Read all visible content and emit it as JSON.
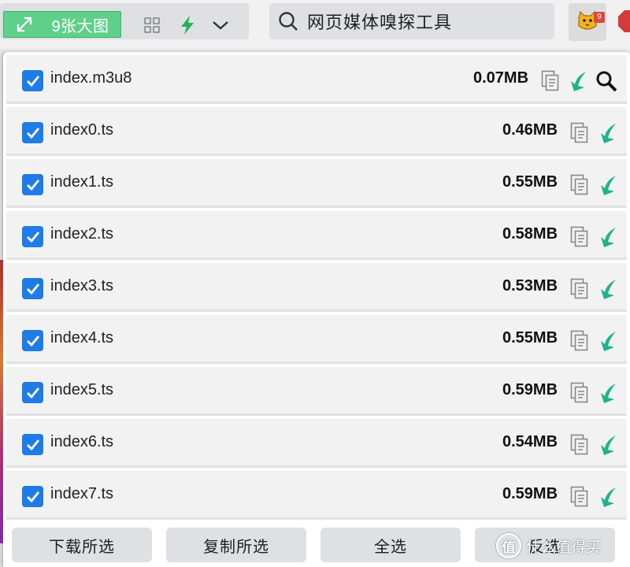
{
  "toolbar": {
    "gallery_label": "9张大图",
    "search_text": "网页媒体嗅探工具",
    "extension_badge": "9",
    "icons": [
      "expand-icon",
      "grid-icon",
      "lightning-icon",
      "chevron-down-icon",
      "search-icon",
      "cat-extension-icon",
      "adblock-icon"
    ]
  },
  "colors": {
    "accent_green": "#5fd08a",
    "download_teal": "#1fb38a",
    "checkbox_blue": "#1f7ce6"
  },
  "files": [
    {
      "name": "index.m3u8",
      "size": "0.07MB",
      "checked": true,
      "has_preview": true
    },
    {
      "name": "index0.ts",
      "size": "0.46MB",
      "checked": true,
      "has_preview": false
    },
    {
      "name": "index1.ts",
      "size": "0.55MB",
      "checked": true,
      "has_preview": false
    },
    {
      "name": "index2.ts",
      "size": "0.58MB",
      "checked": true,
      "has_preview": false
    },
    {
      "name": "index3.ts",
      "size": "0.53MB",
      "checked": true,
      "has_preview": false
    },
    {
      "name": "index4.ts",
      "size": "0.55MB",
      "checked": true,
      "has_preview": false
    },
    {
      "name": "index5.ts",
      "size": "0.59MB",
      "checked": true,
      "has_preview": false
    },
    {
      "name": "index6.ts",
      "size": "0.54MB",
      "checked": true,
      "has_preview": false
    },
    {
      "name": "index7.ts",
      "size": "0.59MB",
      "checked": true,
      "has_preview": false
    }
  ],
  "actions": {
    "download_selected": "下载所选",
    "copy_selected": "复制所选",
    "select_all": "全选",
    "invert_selection": "反选"
  },
  "watermark": {
    "logo_text": "值",
    "text": "什么值得买"
  }
}
